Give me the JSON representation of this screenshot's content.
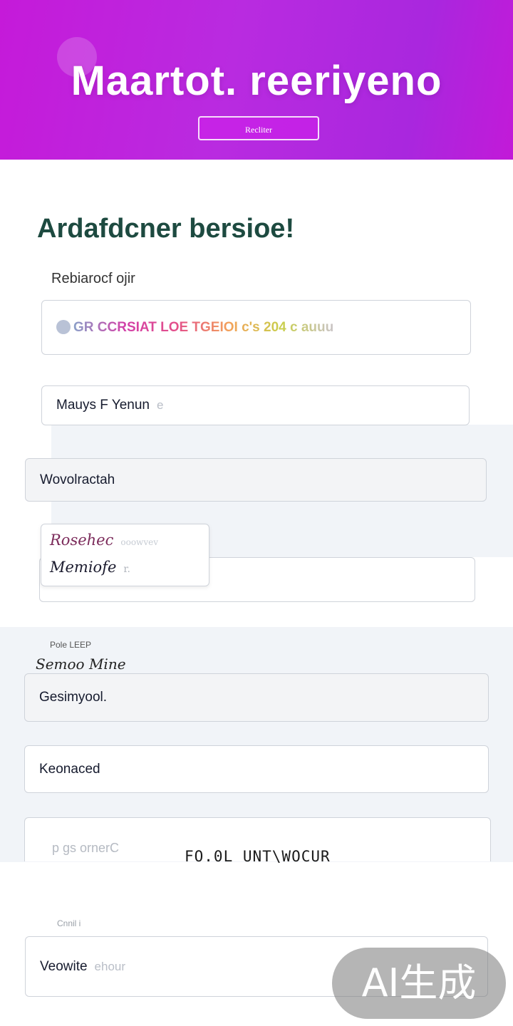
{
  "hero": {
    "title": "Maartot.  reeriyeno",
    "button_label": "Recliter"
  },
  "section": {
    "title": "Ardafdcner bersioe!",
    "label": "Rebiarocf ojir"
  },
  "fields": {
    "field1_value": "GR CCRSIAT LOE TGEIOI c's 204 c auuu",
    "field2_value": "Mauys F Yenun",
    "field2_hint": "e",
    "field3_value": "Wovolractah",
    "popover_line1": "Rosehec",
    "popover_line2": "Memiofe",
    "popover_hint1": "ooowvev",
    "popover_hint2": "r.",
    "field5_small_label": "Pole LEEP",
    "field5_label": "Semoo Mine",
    "field5_value": "Gesimyool.",
    "field6_value": "Keonaced",
    "field7_hint": "p gs   ornerC",
    "field7_value": "FO.0L UNT\\WOCUR",
    "field8_small_label": "Cnnil i",
    "field8_value": "Veowite",
    "field8_hint": "ehour"
  },
  "watermark": "AI生成",
  "colors": {
    "hero_start": "#c51ad9",
    "hero_end": "#a927de",
    "section_title": "#1d4a40"
  }
}
